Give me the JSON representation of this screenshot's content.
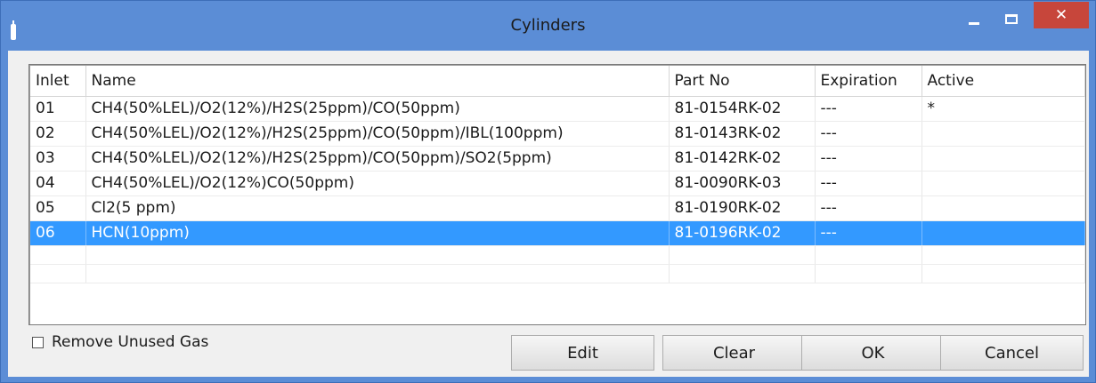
{
  "window": {
    "title": "Cylinders",
    "close_glyph": "✕"
  },
  "table": {
    "columns": [
      "Inlet",
      "Name",
      "Part No",
      "Expiration",
      "Active"
    ],
    "rows": [
      {
        "inlet": "01",
        "name": "CH4(50%LEL)/O2(12%)/H2S(25ppm)/CO(50ppm)",
        "part_no": "81-0154RK-02",
        "expiration": "---",
        "active": "*"
      },
      {
        "inlet": "02",
        "name": "CH4(50%LEL)/O2(12%)/H2S(25ppm)/CO(50ppm)/IBL(100ppm)",
        "part_no": "81-0143RK-02",
        "expiration": "---",
        "active": ""
      },
      {
        "inlet": "03",
        "name": "CH4(50%LEL)/O2(12%)/H2S(25ppm)/CO(50ppm)/SO2(5ppm)",
        "part_no": "81-0142RK-02",
        "expiration": "---",
        "active": ""
      },
      {
        "inlet": "04",
        "name": "CH4(50%LEL)/O2(12%)CO(50ppm)",
        "part_no": "81-0090RK-03",
        "expiration": "---",
        "active": ""
      },
      {
        "inlet": "05",
        "name": "Cl2(5 ppm)",
        "part_no": "81-0190RK-02",
        "expiration": "---",
        "active": ""
      },
      {
        "inlet": "06",
        "name": "HCN(10ppm)",
        "part_no": "81-0196RK-02",
        "expiration": "---",
        "active": ""
      }
    ],
    "selected_inlet": "06"
  },
  "options": {
    "remove_unused_gas_label": "Remove Unused Gas",
    "remove_unused_gas_checked": false
  },
  "buttons": {
    "edit": "Edit",
    "clear": "Clear",
    "ok": "OK",
    "cancel": "Cancel"
  },
  "colors": {
    "titlebar": "#5b8dd6",
    "selection": "#3399ff",
    "close_button": "#c7463b"
  }
}
